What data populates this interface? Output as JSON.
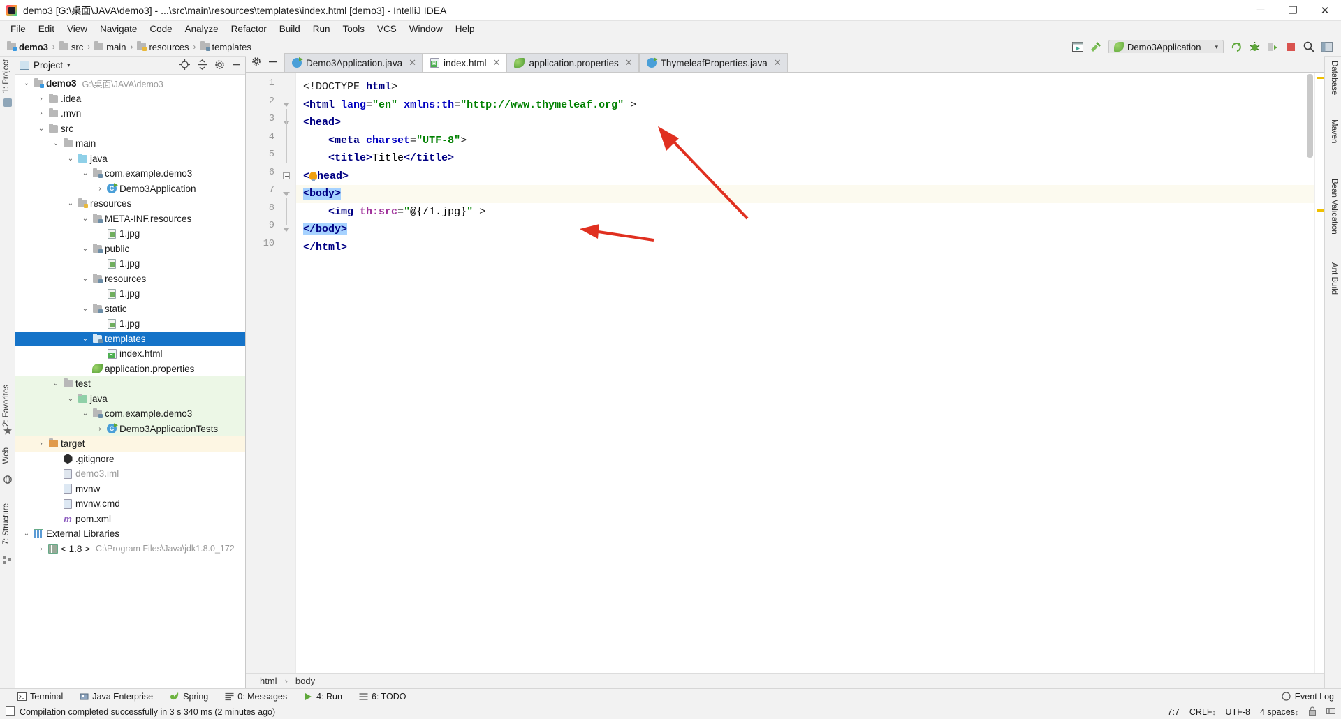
{
  "window": {
    "title": "demo3 [G:\\桌面\\JAVA\\demo3] - ...\\src\\main\\resources\\templates\\index.html [demo3] - IntelliJ IDEA",
    "minimize": "─",
    "maximize": "❐",
    "close": "✕"
  },
  "menubar": {
    "items": [
      "File",
      "Edit",
      "View",
      "Navigate",
      "Code",
      "Analyze",
      "Refactor",
      "Build",
      "Run",
      "Tools",
      "VCS",
      "Window",
      "Help"
    ]
  },
  "navbar": {
    "breadcrumbs": [
      "demo3",
      "src",
      "main",
      "resources",
      "templates"
    ],
    "separator": "›",
    "run_config": "Demo3Application",
    "run_config_caret": "▾"
  },
  "project_panel": {
    "title": "Project",
    "title_caret": "▾",
    "tree": [
      {
        "depth": 0,
        "arrow": "⌄",
        "icon": "module-folder",
        "label": "demo3",
        "bold": true,
        "path": "G:\\桌面\\JAVA\\demo3"
      },
      {
        "depth": 1,
        "arrow": "›",
        "icon": "folder",
        "label": ".idea"
      },
      {
        "depth": 1,
        "arrow": "›",
        "icon": "folder",
        "label": ".mvn"
      },
      {
        "depth": 1,
        "arrow": "⌄",
        "icon": "folder",
        "label": "src"
      },
      {
        "depth": 2,
        "arrow": "⌄",
        "icon": "folder",
        "label": "main"
      },
      {
        "depth": 3,
        "arrow": "⌄",
        "icon": "source-folder",
        "label": "java"
      },
      {
        "depth": 4,
        "arrow": "⌄",
        "icon": "package-folder",
        "label": "com.example.demo3"
      },
      {
        "depth": 5,
        "arrow": "›",
        "icon": "java-class",
        "label": "Demo3Application"
      },
      {
        "depth": 3,
        "arrow": "⌄",
        "icon": "resources-folder",
        "label": "resources"
      },
      {
        "depth": 4,
        "arrow": "⌄",
        "icon": "package-folder",
        "label": "META-INF.resources"
      },
      {
        "depth": 5,
        "arrow": "",
        "icon": "image-file",
        "label": "1.jpg"
      },
      {
        "depth": 4,
        "arrow": "⌄",
        "icon": "package-folder",
        "label": "public"
      },
      {
        "depth": 5,
        "arrow": "",
        "icon": "image-file",
        "label": "1.jpg"
      },
      {
        "depth": 4,
        "arrow": "⌄",
        "icon": "package-folder",
        "label": "resources"
      },
      {
        "depth": 5,
        "arrow": "",
        "icon": "image-file",
        "label": "1.jpg"
      },
      {
        "depth": 4,
        "arrow": "⌄",
        "icon": "package-folder",
        "label": "static"
      },
      {
        "depth": 5,
        "arrow": "",
        "icon": "image-file",
        "label": "1.jpg"
      },
      {
        "depth": 4,
        "arrow": "⌄",
        "icon": "package-folder",
        "label": "templates",
        "selected": true
      },
      {
        "depth": 5,
        "arrow": "",
        "icon": "html-file",
        "label": "index.html"
      },
      {
        "depth": 4,
        "arrow": "",
        "icon": "properties-file",
        "label": "application.properties"
      },
      {
        "depth": 2,
        "arrow": "⌄",
        "icon": "folder",
        "label": "test",
        "scope": "test"
      },
      {
        "depth": 3,
        "arrow": "⌄",
        "icon": "source-folder-test",
        "label": "java",
        "scope": "test"
      },
      {
        "depth": 4,
        "arrow": "⌄",
        "icon": "package-folder",
        "label": "com.example.demo3",
        "scope": "test"
      },
      {
        "depth": 5,
        "arrow": "›",
        "icon": "java-class",
        "label": "Demo3ApplicationTests",
        "scope": "test"
      },
      {
        "depth": 1,
        "arrow": "›",
        "icon": "target-folder",
        "label": "target",
        "scope": "target"
      },
      {
        "depth": 2,
        "arrow": "",
        "icon": "git-file",
        "label": ".gitignore"
      },
      {
        "depth": 2,
        "arrow": "",
        "icon": "iml-file",
        "label": "demo3.iml",
        "dim": true
      },
      {
        "depth": 2,
        "arrow": "",
        "icon": "script-file",
        "label": "mvnw"
      },
      {
        "depth": 2,
        "arrow": "",
        "icon": "script-file",
        "label": "mvnw.cmd"
      },
      {
        "depth": 2,
        "arrow": "",
        "icon": "maven-file",
        "label": "pom.xml"
      },
      {
        "depth": 0,
        "arrow": "⌄",
        "icon": "library",
        "label": "External Libraries"
      },
      {
        "depth": 1,
        "arrow": "›",
        "icon": "jdk",
        "label": "< 1.8 >",
        "path": "C:\\Program Files\\Java\\jdk1.8.0_172"
      }
    ]
  },
  "left_strip": {
    "items": [
      "1: Project",
      "2: Favorites",
      "Web",
      "7: Structure"
    ]
  },
  "right_strip": {
    "items": [
      "Database",
      "Maven",
      "Bean Validation",
      "Ant Build"
    ]
  },
  "editor": {
    "tabs": [
      {
        "label": "Demo3Application.java",
        "icon": "java-class-icon",
        "active": false,
        "close": "✕"
      },
      {
        "label": "index.html",
        "icon": "html-file-icon",
        "active": true,
        "close": "✕"
      },
      {
        "label": "application.properties",
        "icon": "properties-file-icon",
        "active": false,
        "close": "✕"
      },
      {
        "label": "ThymeleafProperties.java",
        "icon": "java-class-icon",
        "active": false,
        "close": "✕"
      }
    ],
    "lines": [
      {
        "num": "1",
        "text": "<!DOCTYPE html>"
      },
      {
        "num": "2",
        "text": "<html lang=\"en\" xmlns:th=\"http://www.thymeleaf.org\" >"
      },
      {
        "num": "3",
        "text": "<head>"
      },
      {
        "num": "4",
        "text": "    <meta charset=\"UTF-8\">"
      },
      {
        "num": "5",
        "text": "    <title>Title</title>"
      },
      {
        "num": "6",
        "text": "</head>"
      },
      {
        "num": "7",
        "text": "<body>"
      },
      {
        "num": "8",
        "text": "    <img th:src=\"@{/1.jpg}\" >"
      },
      {
        "num": "9",
        "text": "</body>"
      },
      {
        "num": "10",
        "text": "</html>"
      }
    ],
    "breadcrumb": [
      "html",
      "body"
    ],
    "breadcrumb_sep": "›"
  },
  "bottom_bar": {
    "items": [
      {
        "label": "Terminal",
        "icon": "terminal-icon"
      },
      {
        "label": "Java Enterprise",
        "icon": "java-enterprise-icon"
      },
      {
        "label": "Spring",
        "icon": "spring-icon"
      },
      {
        "label": "0: Messages",
        "icon": "messages-icon"
      },
      {
        "label": "4: Run",
        "icon": "run-icon"
      },
      {
        "label": "6: TODO",
        "icon": "todo-icon"
      }
    ],
    "event_log": "Event Log"
  },
  "status_bar": {
    "message": "Compilation completed successfully in 3 s 340 ms (2 minutes ago)",
    "caret_position": "7:7",
    "line_separator": "CRLF",
    "line_separator_caret": "↕",
    "encoding": "UTF-8",
    "indent": "4 spaces",
    "indent_caret": "↕"
  },
  "colors": {
    "selection_blue": "#1573c8",
    "caret_line": "#fcfaef",
    "code_selection": "#a6d2ff",
    "tag_blue": "#000083",
    "string_green": "#008000",
    "thymeleaf_purple": "#a0329b",
    "annotation_red": "#e03020"
  }
}
